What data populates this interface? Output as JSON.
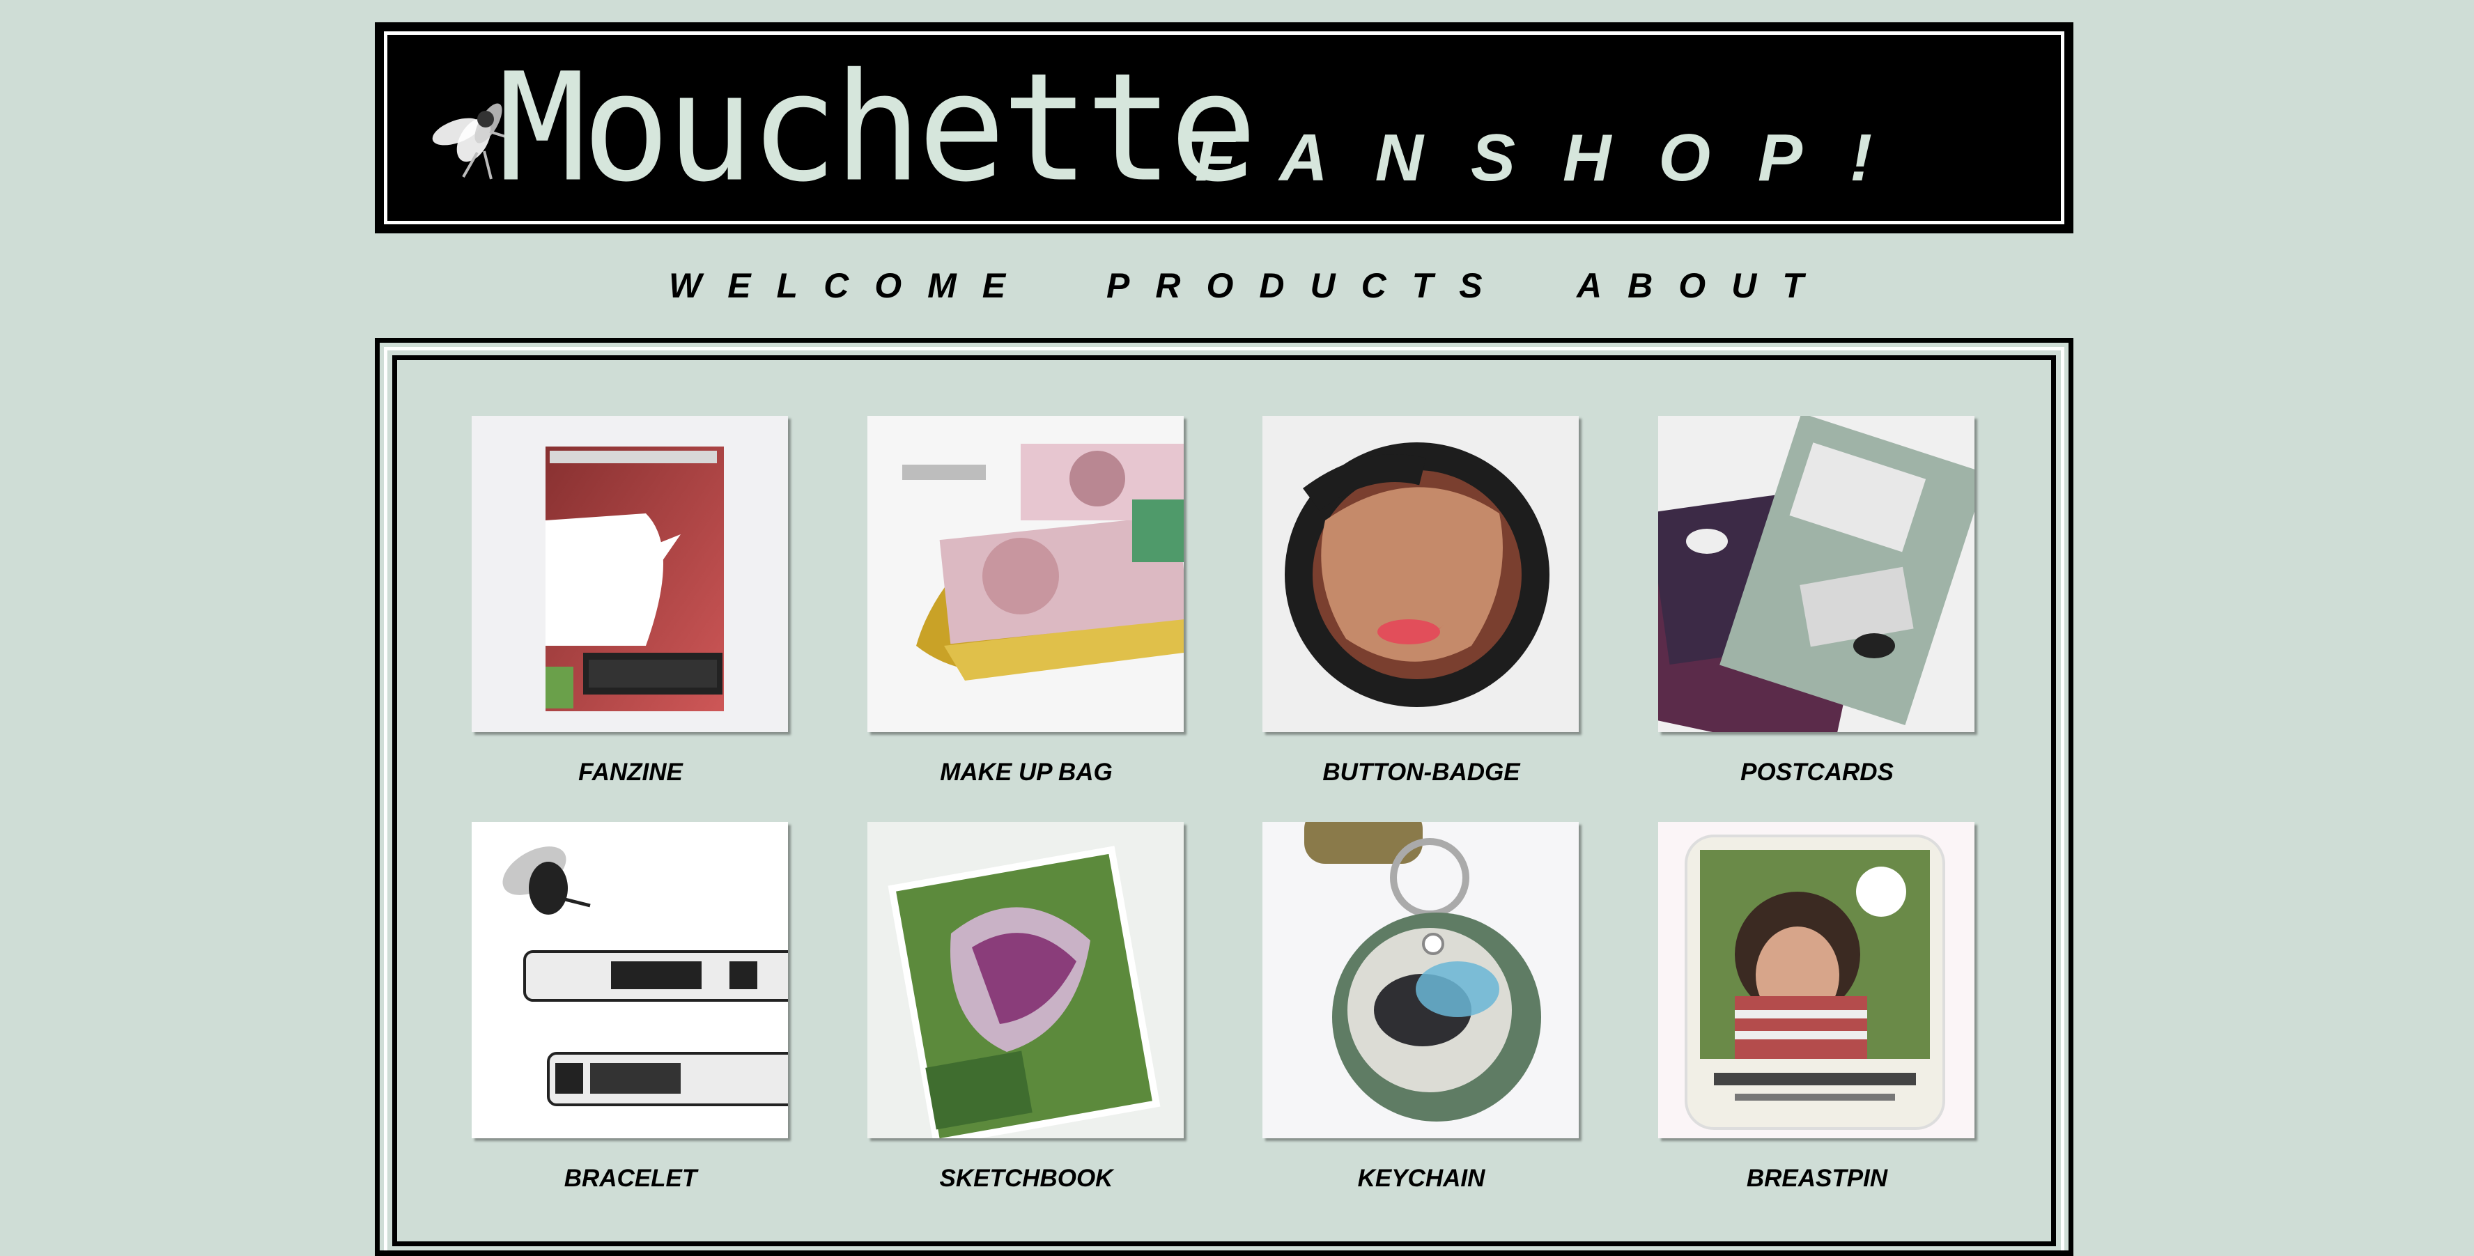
{
  "banner": {
    "logo_word": "Mouchette",
    "logo_sub": "FANSHOP!",
    "logo_icon": "fly-icon"
  },
  "nav": {
    "items": [
      {
        "label": "WELCOME"
      },
      {
        "label": "PRODUCTS"
      },
      {
        "label": "ABOUT"
      }
    ]
  },
  "products": [
    {
      "label": "FANZINE",
      "icon": "fanzine-photo"
    },
    {
      "label": "MAKE UP BAG",
      "icon": "makeup-bag-photo"
    },
    {
      "label": "BUTTON-BADGE",
      "icon": "button-badge-photo"
    },
    {
      "label": "POSTCARDS",
      "icon": "postcards-photo"
    },
    {
      "label": "BRACELET",
      "icon": "bracelet-photo"
    },
    {
      "label": "SKETCHBOOK",
      "icon": "sketchbook-photo"
    },
    {
      "label": "KEYCHAIN",
      "icon": "keychain-photo"
    },
    {
      "label": "BREASTPIN",
      "icon": "breastpin-photo"
    }
  ],
  "colors": {
    "background": "#cfddd6",
    "banner_bg": "#000000",
    "logo_text": "#d6e6dc"
  }
}
